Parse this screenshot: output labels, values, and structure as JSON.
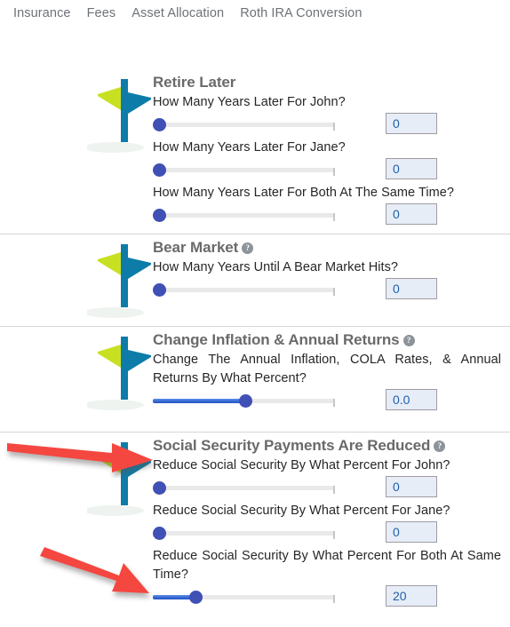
{
  "tabs": [
    {
      "label": "Insurance"
    },
    {
      "label": "Fees"
    },
    {
      "label": "Asset Allocation"
    },
    {
      "label": "Roth IRA Conversion"
    }
  ],
  "help_glyph": "?",
  "colors": {
    "signpost_green": "#c8e022",
    "signpost_teal": "#0d7ca8",
    "slider_knob": "#4050b5",
    "slider_fill": "#2352c0",
    "slider_track": "#e9e9e9",
    "value_text": "#2060a8",
    "value_bg": "#e7edf7",
    "title_text": "#6a6a6a",
    "tab_text": "#6d7278",
    "arrow_red": "#f4473f"
  },
  "sections": [
    {
      "id": "retire-later",
      "title": "Retire Later",
      "has_help": false,
      "icon": "signpost-icon",
      "rows": [
        {
          "label": "How Many Years Later For John?",
          "value": "0",
          "fill_pct": 0,
          "justify": false
        },
        {
          "label": "How Many Years Later For Jane?",
          "value": "0",
          "fill_pct": 0,
          "justify": false
        },
        {
          "label": "How Many Years Later For Both At The Same Time?",
          "value": "0",
          "fill_pct": 0,
          "justify": false
        }
      ]
    },
    {
      "id": "bear-market",
      "title": "Bear Market",
      "has_help": true,
      "icon": "signpost-icon",
      "rows": [
        {
          "label": "How Many Years Until A Bear Market Hits?",
          "value": "0",
          "fill_pct": 0,
          "justify": false
        }
      ]
    },
    {
      "id": "change-inflation-annual-returns",
      "title": "Change Inflation & Annual Returns",
      "has_help": true,
      "icon": "signpost-icon",
      "rows": [
        {
          "label": "Change The Annual Inflation, COLA Rates, & Annual Returns By What Percent?",
          "value": "0.0",
          "fill_pct": 50,
          "justify": true
        }
      ]
    },
    {
      "id": "social-security-payments-are-reduced",
      "title": "Social Security Payments Are Reduced",
      "has_help": true,
      "icon": "signpost-icon",
      "rows": [
        {
          "label": "Reduce Social Security By What Percent For John?",
          "value": "0",
          "fill_pct": 0,
          "justify": false
        },
        {
          "label": "Reduce Social Security By What Percent For Jane?",
          "value": "0",
          "fill_pct": 0,
          "justify": false
        },
        {
          "label": "Reduce Social Security By What Percent For Both At Same Time?",
          "value": "20",
          "fill_pct": 20,
          "justify": true
        }
      ]
    }
  ],
  "annotations": [
    {
      "name": "arrow-to-social-security-title"
    },
    {
      "name": "arrow-to-both-at-same-time-slider"
    }
  ]
}
